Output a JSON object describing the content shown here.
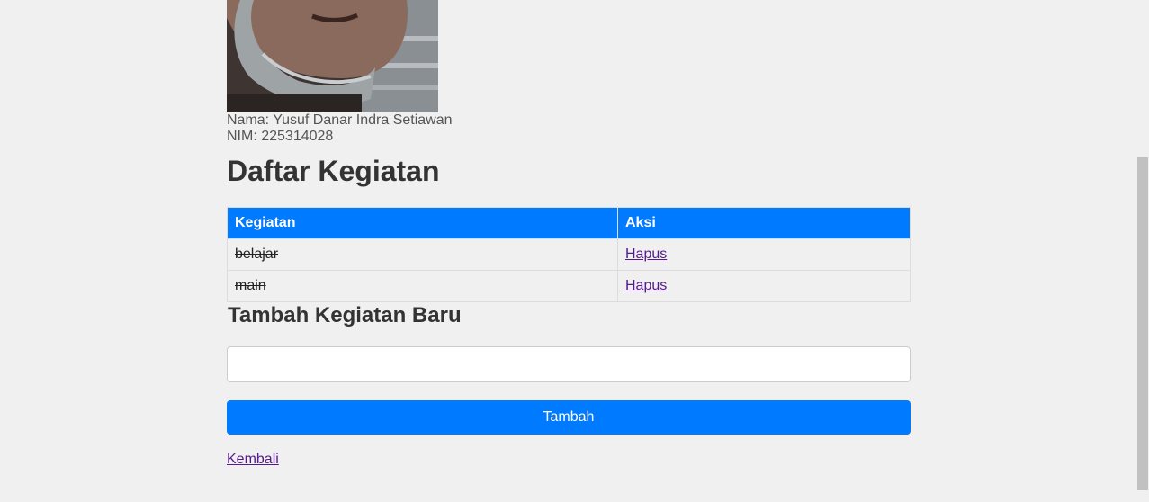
{
  "profile": {
    "name_label": "Nama: Yusuf Danar Indra Setiawan",
    "nim_label": "NIM: 225314028"
  },
  "page_title": "Daftar Kegiatan",
  "table": {
    "headers": [
      "Kegiatan",
      "Aksi"
    ],
    "rows": [
      {
        "activity": "belajar",
        "action": "Hapus",
        "completed": true
      },
      {
        "activity": "main",
        "action": "Hapus",
        "completed": true
      }
    ]
  },
  "form": {
    "title": "Tambah Kegiatan Baru",
    "input_value": "",
    "submit_label": "Tambah"
  },
  "back_link": "Kembali",
  "colors": {
    "accent": "#007bff",
    "background": "#f0f0f0",
    "visited_link": "#551a8b"
  }
}
